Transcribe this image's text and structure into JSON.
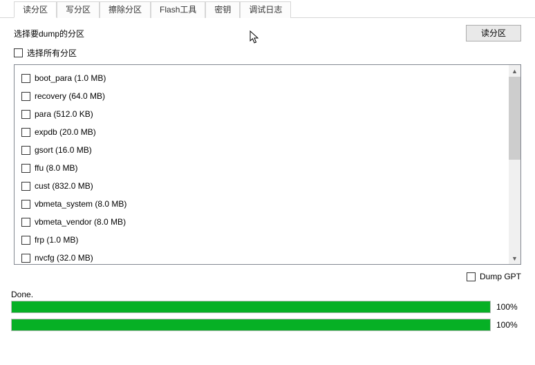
{
  "tabs": {
    "items": [
      {
        "label": "读分区",
        "active": true
      },
      {
        "label": "写分区",
        "active": false
      },
      {
        "label": "擦除分区",
        "active": false
      },
      {
        "label": "Flash工具",
        "active": false
      },
      {
        "label": "密钥",
        "active": false
      },
      {
        "label": "调试日志",
        "active": false
      }
    ]
  },
  "header": {
    "prompt": "选择要dump的分区",
    "action_button": "读分区"
  },
  "select_all": {
    "label": "选择所有分区",
    "checked": false
  },
  "partitions": [
    {
      "label": "boot_para (1.0 MB)",
      "checked": false
    },
    {
      "label": "recovery (64.0 MB)",
      "checked": false
    },
    {
      "label": "para (512.0 KB)",
      "checked": false
    },
    {
      "label": "expdb (20.0 MB)",
      "checked": false
    },
    {
      "label": "gsort (16.0 MB)",
      "checked": false
    },
    {
      "label": "ffu (8.0 MB)",
      "checked": false
    },
    {
      "label": "cust (832.0 MB)",
      "checked": false
    },
    {
      "label": "vbmeta_system (8.0 MB)",
      "checked": false
    },
    {
      "label": "vbmeta_vendor (8.0 MB)",
      "checked": false
    },
    {
      "label": "frp (1.0 MB)",
      "checked": false
    },
    {
      "label": "nvcfg (32.0 MB)",
      "checked": false
    }
  ],
  "dump_gpt": {
    "label": "Dump GPT",
    "checked": false
  },
  "progress": {
    "status": "Done.",
    "bars": [
      {
        "percent_label": "100%",
        "fill_pct": 100
      },
      {
        "percent_label": "100%",
        "fill_pct": 100
      }
    ]
  },
  "icons": {
    "scroll_up": "▲",
    "scroll_down": "▼"
  }
}
